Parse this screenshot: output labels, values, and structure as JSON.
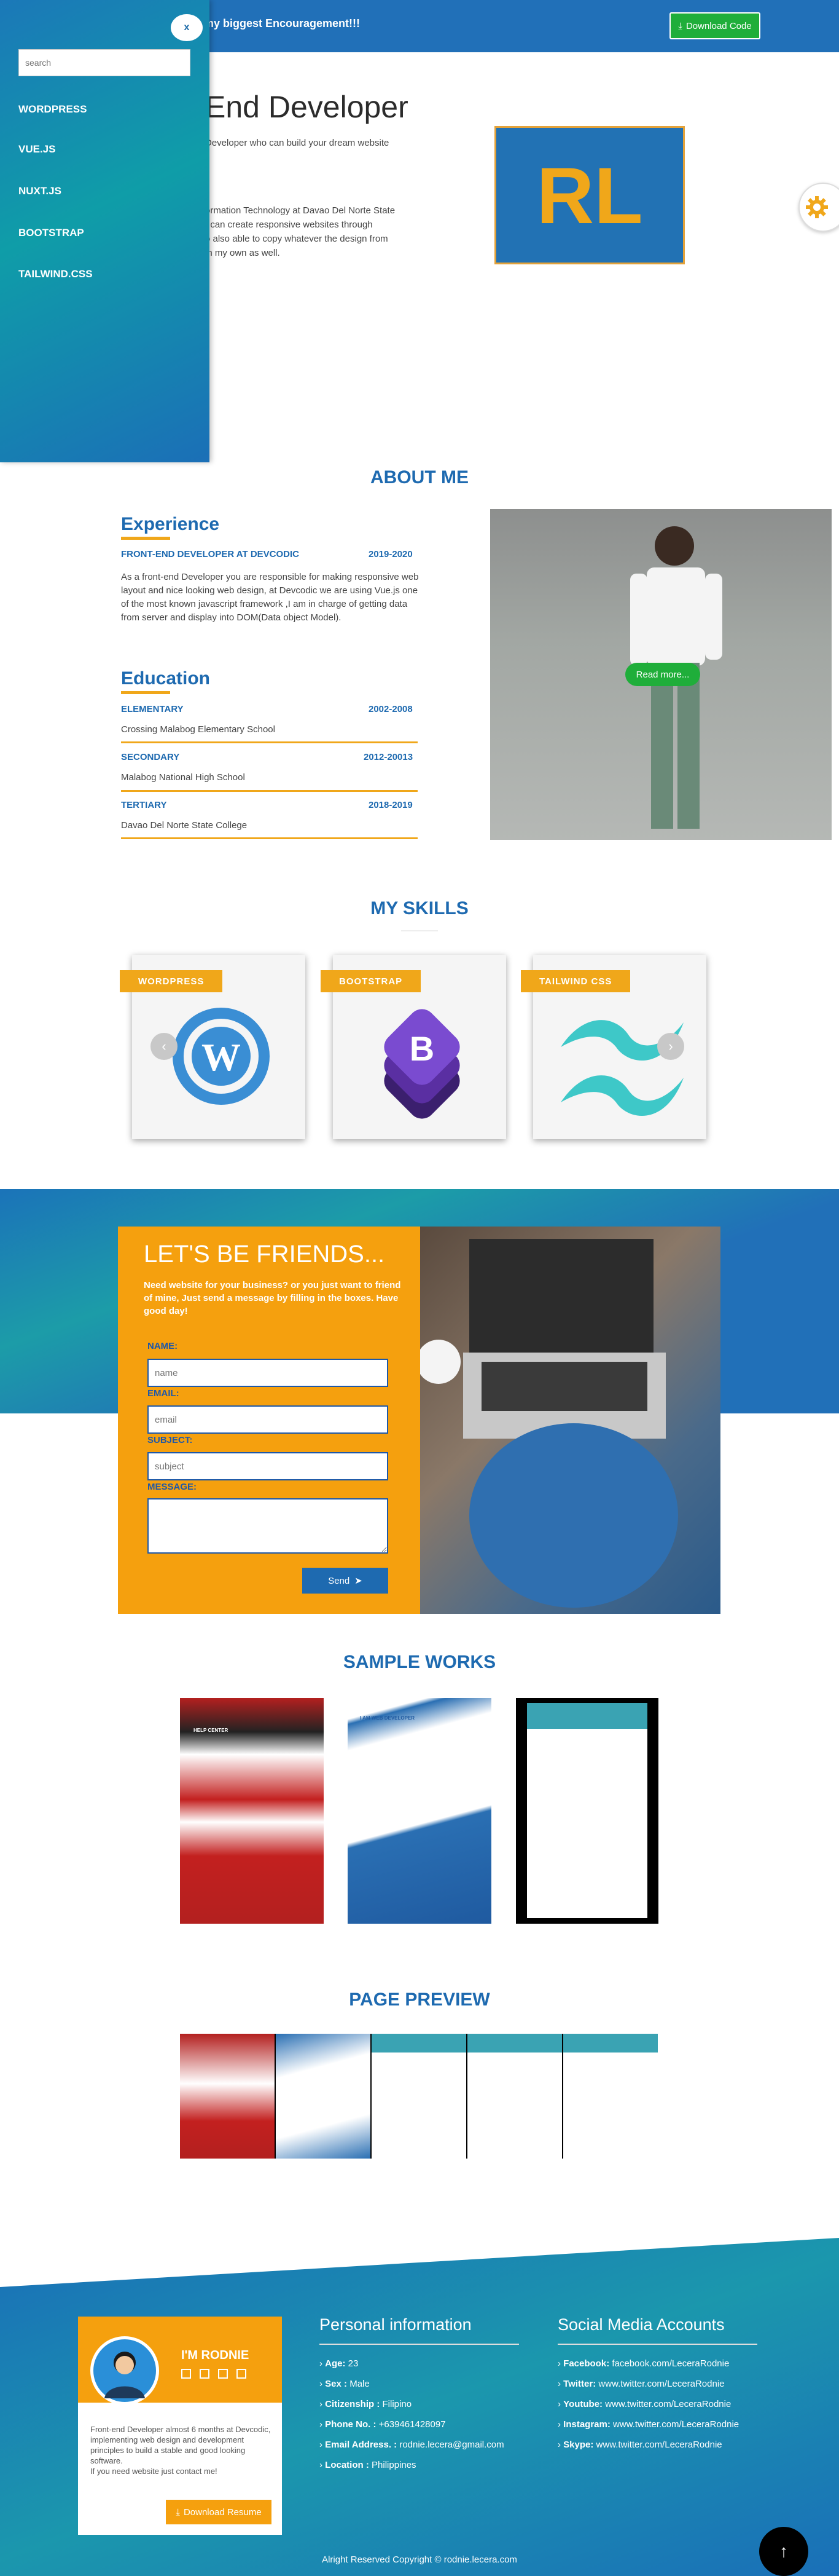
{
  "topbar": {
    "message": "my biggest Encouragement!!!",
    "download_code": "Download Code"
  },
  "sidebar": {
    "close": "x",
    "search_placeholder": "search",
    "items": [
      "WORDPRESS",
      "VUE.JS",
      "NUXT.JS",
      "BOOTSTRAP",
      "TAILWIND.CSS"
    ]
  },
  "hero": {
    "title": "End Developer",
    "line1": "Developer who can build your dream website",
    "line2": "ormation Technology at Davao Del Norte State",
    "line3": "I can create responsive websites through",
    "line4": "o also able to copy whatever the design from",
    "line5": "in my own as well.",
    "logo": "RL"
  },
  "about": {
    "title": "ABOUT ME",
    "experience": {
      "heading": "Experience",
      "role": "FRONT-END DEVELOPER AT DEVCODIC",
      "years": "2019-2020",
      "desc": "As a front-end Developer you are responsible for making responsive web layout and nice looking web design, at Devcodic we are using Vue.js one of the most known javascript framework ,I am in charge of getting data from server and display into DOM(Data object Model)."
    },
    "education": {
      "heading": "Education",
      "items": [
        {
          "level": "ELEMENTARY",
          "years": "2002-2008",
          "school": "Crossing Malabog Elementary School"
        },
        {
          "level": "SECONDARY",
          "years": "2012-20013",
          "school": "Malabog National High School"
        },
        {
          "level": "TERTIARY",
          "years": "2018-2019",
          "school": "Davao Del Norte State College"
        }
      ]
    },
    "read_more": "Read more..."
  },
  "skills": {
    "title": "MY SKILLS",
    "cards": [
      "WORDPRESS",
      "BOOTSTRAP",
      "TAILWIND CSS"
    ]
  },
  "friends": {
    "title": "LET'S BE FRIENDS...",
    "subtitle": "Need website for your business? or you just want to friend of mine, Just send a message by filling in the boxes. Have good day!",
    "name_label": "NAME:",
    "name_placeholder": "name",
    "email_label": "EMAIL:",
    "email_placeholder": "email",
    "subject_label": "SUBJECT:",
    "subject_placeholder": "subject",
    "message_label": "MESSAGE:",
    "send": "Send"
  },
  "works": {
    "title": "SAMPLE WORKS",
    "preview_title": "PAGE PREVIEW",
    "thumb_text": {
      "a": "HELP CENTER",
      "b": "I AM WEB DEVELOPER"
    }
  },
  "footer": {
    "name": "I'M RODNIE",
    "desc": "Front-end Developer almost 6 months at Devcodic, implementing web design and development principles to build a stable and good looking software.",
    "desc2": "If you need website just contact me!",
    "download_resume": "Download Resume",
    "personal_title": "Personal information",
    "personal": [
      {
        "k": "Age:",
        "v": " 23"
      },
      {
        "k": "Sex :",
        "v": " Male"
      },
      {
        "k": "Citizenship :",
        "v": " Filipino"
      },
      {
        "k": "Phone No. :",
        "v": " +639461428097"
      },
      {
        "k": "Email Address. :",
        "v": " rodnie.lecera@gmail.com"
      },
      {
        "k": "Location :",
        "v": " Philippines"
      }
    ],
    "social_title": "Social Media Accounts",
    "social": [
      {
        "k": "Facebook:",
        "v": " facebook.com/LeceraRodnie"
      },
      {
        "k": "Twitter:",
        "v": " www.twitter.com/LeceraRodnie"
      },
      {
        "k": "Youtube:",
        "v": " www.twitter.com/LeceraRodnie"
      },
      {
        "k": "Instagram:",
        "v": " www.twitter.com/LeceraRodnie"
      },
      {
        "k": "Skype:",
        "v": " www.twitter.com/LeceraRodnie"
      }
    ],
    "copyright": "Alright Reserved Copyright © rodnie.lecera.com"
  },
  "colors": {
    "primary": "#2170b8",
    "accent": "#f0a71a",
    "success": "#1fae3a"
  }
}
